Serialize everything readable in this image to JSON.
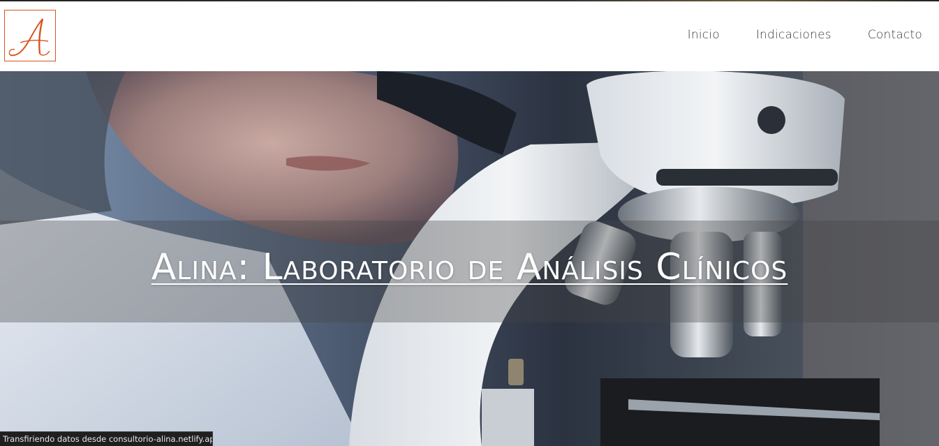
{
  "header": {
    "logo_letter": "A",
    "nav": [
      {
        "label": "Inicio"
      },
      {
        "label": "Indicaciones"
      },
      {
        "label": "Contacto"
      }
    ]
  },
  "hero": {
    "title": "Alina: Laboratorio de Análisis Clínicos",
    "image_label": "microscope-lab-photo"
  },
  "status_bar": {
    "text": "Transfiriendo datos desde consultorio-alina.netlify.app..."
  },
  "colors": {
    "accent": "#d9531e",
    "nav_text": "#3a3a3a",
    "title_text": "#ffffff",
    "status_bg": "#1f1f1f"
  }
}
